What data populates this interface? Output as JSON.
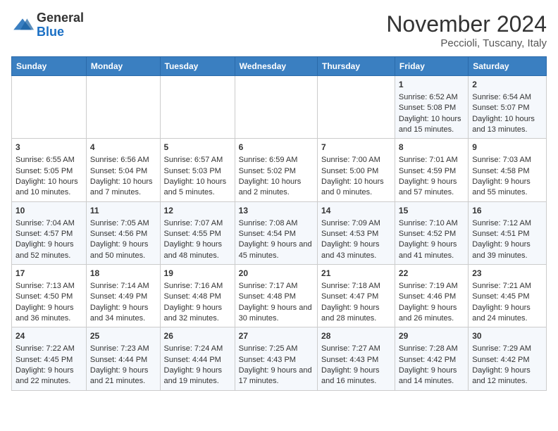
{
  "header": {
    "logo_line1": "General",
    "logo_line2": "Blue",
    "month": "November 2024",
    "location": "Peccioli, Tuscany, Italy"
  },
  "days_of_week": [
    "Sunday",
    "Monday",
    "Tuesday",
    "Wednesday",
    "Thursday",
    "Friday",
    "Saturday"
  ],
  "weeks": [
    [
      {
        "day": "",
        "content": ""
      },
      {
        "day": "",
        "content": ""
      },
      {
        "day": "",
        "content": ""
      },
      {
        "day": "",
        "content": ""
      },
      {
        "day": "",
        "content": ""
      },
      {
        "day": "1",
        "content": "Sunrise: 6:52 AM\nSunset: 5:08 PM\nDaylight: 10 hours and 15 minutes."
      },
      {
        "day": "2",
        "content": "Sunrise: 6:54 AM\nSunset: 5:07 PM\nDaylight: 10 hours and 13 minutes."
      }
    ],
    [
      {
        "day": "3",
        "content": "Sunrise: 6:55 AM\nSunset: 5:05 PM\nDaylight: 10 hours and 10 minutes."
      },
      {
        "day": "4",
        "content": "Sunrise: 6:56 AM\nSunset: 5:04 PM\nDaylight: 10 hours and 7 minutes."
      },
      {
        "day": "5",
        "content": "Sunrise: 6:57 AM\nSunset: 5:03 PM\nDaylight: 10 hours and 5 minutes."
      },
      {
        "day": "6",
        "content": "Sunrise: 6:59 AM\nSunset: 5:02 PM\nDaylight: 10 hours and 2 minutes."
      },
      {
        "day": "7",
        "content": "Sunrise: 7:00 AM\nSunset: 5:00 PM\nDaylight: 10 hours and 0 minutes."
      },
      {
        "day": "8",
        "content": "Sunrise: 7:01 AM\nSunset: 4:59 PM\nDaylight: 9 hours and 57 minutes."
      },
      {
        "day": "9",
        "content": "Sunrise: 7:03 AM\nSunset: 4:58 PM\nDaylight: 9 hours and 55 minutes."
      }
    ],
    [
      {
        "day": "10",
        "content": "Sunrise: 7:04 AM\nSunset: 4:57 PM\nDaylight: 9 hours and 52 minutes."
      },
      {
        "day": "11",
        "content": "Sunrise: 7:05 AM\nSunset: 4:56 PM\nDaylight: 9 hours and 50 minutes."
      },
      {
        "day": "12",
        "content": "Sunrise: 7:07 AM\nSunset: 4:55 PM\nDaylight: 9 hours and 48 minutes."
      },
      {
        "day": "13",
        "content": "Sunrise: 7:08 AM\nSunset: 4:54 PM\nDaylight: 9 hours and 45 minutes."
      },
      {
        "day": "14",
        "content": "Sunrise: 7:09 AM\nSunset: 4:53 PM\nDaylight: 9 hours and 43 minutes."
      },
      {
        "day": "15",
        "content": "Sunrise: 7:10 AM\nSunset: 4:52 PM\nDaylight: 9 hours and 41 minutes."
      },
      {
        "day": "16",
        "content": "Sunrise: 7:12 AM\nSunset: 4:51 PM\nDaylight: 9 hours and 39 minutes."
      }
    ],
    [
      {
        "day": "17",
        "content": "Sunrise: 7:13 AM\nSunset: 4:50 PM\nDaylight: 9 hours and 36 minutes."
      },
      {
        "day": "18",
        "content": "Sunrise: 7:14 AM\nSunset: 4:49 PM\nDaylight: 9 hours and 34 minutes."
      },
      {
        "day": "19",
        "content": "Sunrise: 7:16 AM\nSunset: 4:48 PM\nDaylight: 9 hours and 32 minutes."
      },
      {
        "day": "20",
        "content": "Sunrise: 7:17 AM\nSunset: 4:48 PM\nDaylight: 9 hours and 30 minutes."
      },
      {
        "day": "21",
        "content": "Sunrise: 7:18 AM\nSunset: 4:47 PM\nDaylight: 9 hours and 28 minutes."
      },
      {
        "day": "22",
        "content": "Sunrise: 7:19 AM\nSunset: 4:46 PM\nDaylight: 9 hours and 26 minutes."
      },
      {
        "day": "23",
        "content": "Sunrise: 7:21 AM\nSunset: 4:45 PM\nDaylight: 9 hours and 24 minutes."
      }
    ],
    [
      {
        "day": "24",
        "content": "Sunrise: 7:22 AM\nSunset: 4:45 PM\nDaylight: 9 hours and 22 minutes."
      },
      {
        "day": "25",
        "content": "Sunrise: 7:23 AM\nSunset: 4:44 PM\nDaylight: 9 hours and 21 minutes."
      },
      {
        "day": "26",
        "content": "Sunrise: 7:24 AM\nSunset: 4:44 PM\nDaylight: 9 hours and 19 minutes."
      },
      {
        "day": "27",
        "content": "Sunrise: 7:25 AM\nSunset: 4:43 PM\nDaylight: 9 hours and 17 minutes."
      },
      {
        "day": "28",
        "content": "Sunrise: 7:27 AM\nSunset: 4:43 PM\nDaylight: 9 hours and 16 minutes."
      },
      {
        "day": "29",
        "content": "Sunrise: 7:28 AM\nSunset: 4:42 PM\nDaylight: 9 hours and 14 minutes."
      },
      {
        "day": "30",
        "content": "Sunrise: 7:29 AM\nSunset: 4:42 PM\nDaylight: 9 hours and 12 minutes."
      }
    ]
  ]
}
